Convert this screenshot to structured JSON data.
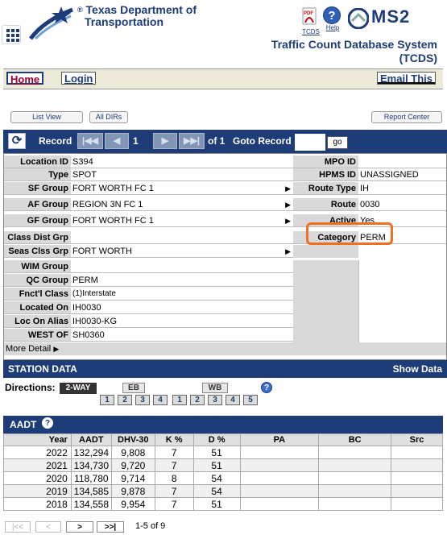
{
  "header": {
    "org_line1": "Texas Department of",
    "org_line2": "Transportation",
    "registered": "®",
    "tcds_icon_label": "TCDS",
    "help_icon_label": "Help",
    "brand": "MS2",
    "system_title_line1": "Traffic Count Database System",
    "system_title_line2": "(TCDS)"
  },
  "nav": {
    "home": "Home",
    "login": "Login",
    "email": "Email This"
  },
  "toolbar": {
    "list_view": "List View",
    "all_dirs": "All DIRs",
    "report_center": "Report Center"
  },
  "record_nav": {
    "label": "Record",
    "current": "1",
    "of_total": "of 1",
    "goto_label": "Goto Record",
    "go_label": "go",
    "goto_value": ""
  },
  "fields": {
    "location_id": {
      "label": "Location ID",
      "value": "S394"
    },
    "type": {
      "label": "Type",
      "value": "SPOT"
    },
    "sf_group": {
      "label": "SF Group",
      "value": "FORT WORTH FC 1"
    },
    "af_group": {
      "label": "AF Group",
      "value": "REGION 3N FC 1"
    },
    "gf_group": {
      "label": "GF Group",
      "value": "FORT WORTH FC 1"
    },
    "class_dist_grp": {
      "label": "Class Dist Grp",
      "value": ""
    },
    "seas_clss_grp": {
      "label": "Seas Clss Grp",
      "value": "FORT WORTH"
    },
    "wim_group": {
      "label": "WIM Group",
      "value": ""
    },
    "qc_group": {
      "label": "QC Group",
      "value": "PERM"
    },
    "fnctl_class": {
      "label": "Fnct'l Class",
      "value": "(1)Interstate"
    },
    "located_on": {
      "label": "Located On",
      "value": "IH0030"
    },
    "loc_on_alias": {
      "label": "Loc On Alias",
      "value": "IH0030-KG"
    },
    "west_of": {
      "label": "WEST OF",
      "value": "SH0360"
    },
    "mpo_id": {
      "label": "MPO ID",
      "value": ""
    },
    "hpms_id": {
      "label": "HPMS ID",
      "value": "UNASSIGNED"
    },
    "route_type": {
      "label": "Route Type",
      "value": "IH"
    },
    "route": {
      "label": "Route",
      "value": "0030"
    },
    "active": {
      "label": "Active",
      "value": "Yes"
    },
    "category": {
      "label": "Category",
      "value": "PERM"
    },
    "more_detail": "More Detail"
  },
  "station": {
    "title": "STATION DATA",
    "show_data": "Show Data",
    "directions_label": "Directions:",
    "two_way": "2-WAY",
    "eb_label": "EB",
    "wb_label": "WB",
    "eb_lanes": [
      "1",
      "2",
      "3",
      "4"
    ],
    "wb_lanes": [
      "1",
      "2",
      "3",
      "4",
      "5"
    ]
  },
  "aadt": {
    "title": "AADT",
    "columns": [
      "Year",
      "AADT",
      "DHV-30",
      "K %",
      "D %",
      "PA",
      "BC",
      "Src"
    ],
    "rows": [
      [
        "2022",
        "132,294",
        "9,808",
        "7",
        "51",
        "",
        "",
        ""
      ],
      [
        "2021",
        "134,730",
        "9,720",
        "7",
        "51",
        "",
        "",
        ""
      ],
      [
        "2020",
        "118,780",
        "9,714",
        "8",
        "54",
        "",
        "",
        ""
      ],
      [
        "2019",
        "134,585",
        "9,878",
        "7",
        "54",
        "",
        "",
        ""
      ],
      [
        "2018",
        "134,558",
        "9,954",
        "7",
        "51",
        "",
        "",
        ""
      ]
    ],
    "pager": {
      "first": "|<<",
      "prev": "<",
      "next": ">",
      "last": ">>|",
      "range": "1-5 of 9"
    }
  },
  "colors": {
    "brand_blue": "#1d3c78",
    "highlight_orange": "#f07020",
    "home_red": "#a0002a"
  },
  "icons": [
    "menu-grid-icon",
    "txdot-star-logo-icon",
    "pdf-icon",
    "help-icon",
    "ms2-logo-icon",
    "refresh-icon",
    "first-icon",
    "prev-icon",
    "next-icon",
    "last-icon",
    "triangle-right-icon"
  ]
}
